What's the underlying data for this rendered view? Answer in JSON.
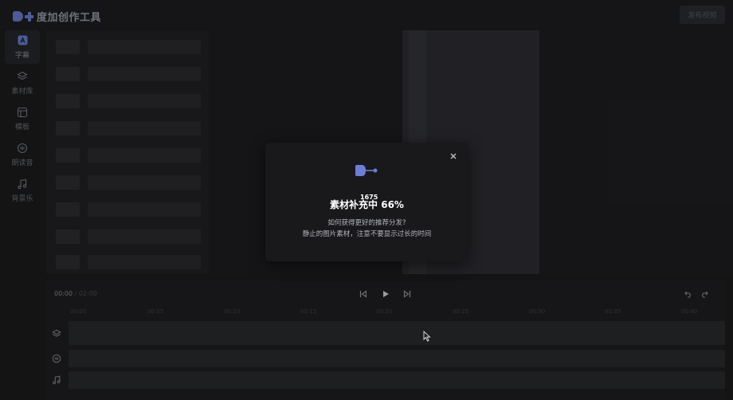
{
  "app": {
    "title": "度加创作工具",
    "publish_label": "发布视频",
    "accent_color": "#6c7fd6"
  },
  "sidebar": {
    "items": [
      {
        "label": "字幕",
        "icon": "subtitle-icon",
        "active": true
      },
      {
        "label": "素材库",
        "icon": "layers-icon",
        "active": false
      },
      {
        "label": "模板",
        "icon": "template-icon",
        "active": false
      },
      {
        "label": "朗读音",
        "icon": "voice-icon",
        "active": false
      },
      {
        "label": "背景乐",
        "icon": "music-note-icon",
        "active": false
      }
    ]
  },
  "timeline": {
    "current_time": "00:00",
    "separator": " / ",
    "total_time": "02:00",
    "ticks": [
      "00:00",
      "00:05",
      "00:10",
      "00:15",
      "00:20",
      "00:25",
      "00:30",
      "00:35",
      "00:40"
    ],
    "controls": [
      "skip-back-icon",
      "play-icon",
      "skip-forward-icon",
      "undo-icon",
      "redo-icon"
    ],
    "tracks": [
      "layers-icon",
      "voice-icon",
      "music-note-icon"
    ]
  },
  "modal": {
    "counter": "1675",
    "title": "素材补充中 66%",
    "progress_percent": 66,
    "line1": "如何获得更好的推荐分发?",
    "line2": "静止的图片素材，注意不要显示过长的时间",
    "close_icon": "close-icon"
  }
}
